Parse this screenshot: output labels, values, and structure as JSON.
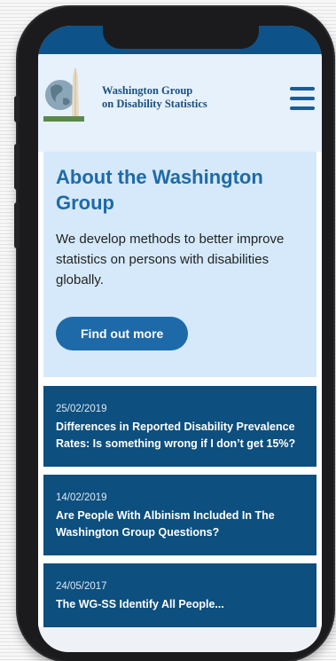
{
  "site": {
    "brand_line1": "Washington Group",
    "brand_line2": "on Disability Statistics"
  },
  "hero": {
    "title": "About the Washington Group",
    "description": "We develop methods to better improve statistics on persons with disabilities globally.",
    "cta_label": "Find out more"
  },
  "news": [
    {
      "date": "25/02/2019",
      "title": "Differences in Reported Disability Prevalence Rates: Is something wrong if I don’t get 15%?"
    },
    {
      "date": "14/02/2019",
      "title": "Are People With Albinism Included In The Washington Group Questions?"
    },
    {
      "date": "24/05/2017",
      "title": "The WG-SS Identify All People..."
    }
  ],
  "colors": {
    "primary": "#1e6aa8",
    "dark_blue": "#0d4f7e",
    "light_blue": "#d5e9fa"
  },
  "icons": {
    "logo": "globe-monument-logo",
    "menu": "hamburger-menu-icon"
  }
}
